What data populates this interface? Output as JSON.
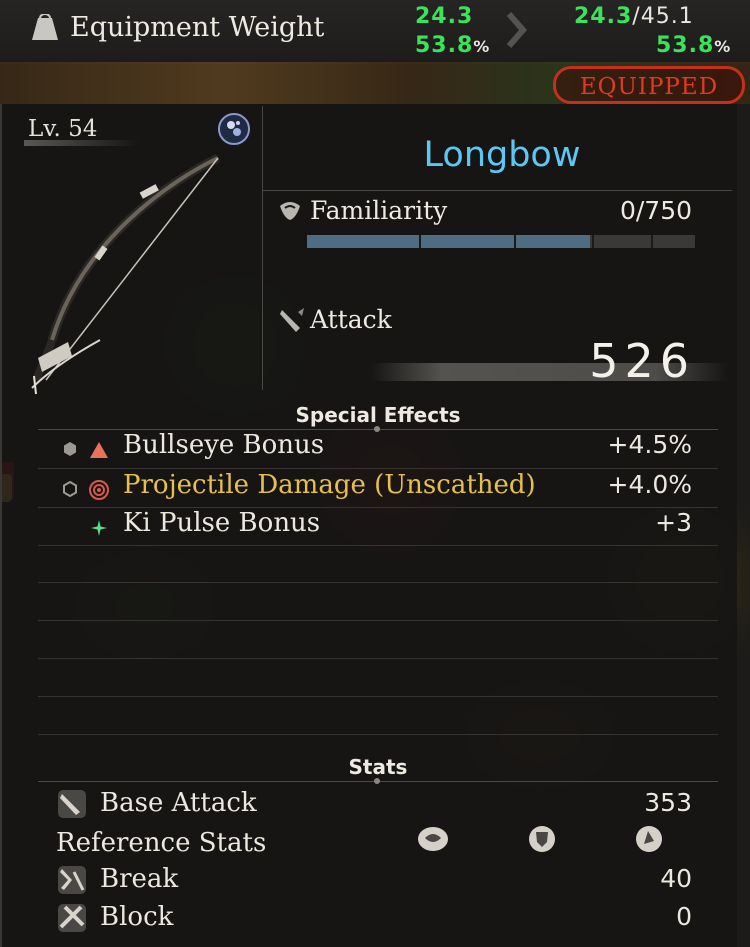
{
  "header": {
    "weight_label": "Equipment Weight",
    "current_weight": "24.3",
    "current_pct": "53.8",
    "new_weight": "24.3",
    "max_weight": "45.1",
    "new_pct": "53.8",
    "pct_symbol": "%",
    "equipped_badge": "EQUIPPED"
  },
  "weapon": {
    "level": "Lv. 54",
    "name": "Longbow",
    "familiarity_label": "Familiarity",
    "familiarity_value": "0/750",
    "familiarity_fraction": 0.73,
    "attack_label": "Attack",
    "attack_value": "526"
  },
  "special_effects": {
    "title": "Special Effects",
    "items": [
      {
        "name": "Bullseye Bonus",
        "value": "+4.5%",
        "symbol": "triangle-icon",
        "color": "#e8735a"
      },
      {
        "name": "Projectile Damage (Unscathed)",
        "value": "+4.0%",
        "symbol": "target-icon",
        "color": "#d95a4a"
      },
      {
        "name": "Ki Pulse Bonus",
        "value": "+3",
        "symbol": "sparkle-icon",
        "color": "#5fe08a"
      }
    ]
  },
  "stats": {
    "title": "Stats",
    "base_attack_label": "Base Attack",
    "base_attack_value": "353",
    "reference_label": "Reference Stats",
    "break_label": "Break",
    "break_value": "40",
    "block_label": "Block",
    "block_value": "0"
  },
  "colors": {
    "weapon_name": "#5cc7f2",
    "weight_green": "#39e45b",
    "equipped_red": "#e03b22",
    "gold_text": "#e7c04c"
  }
}
